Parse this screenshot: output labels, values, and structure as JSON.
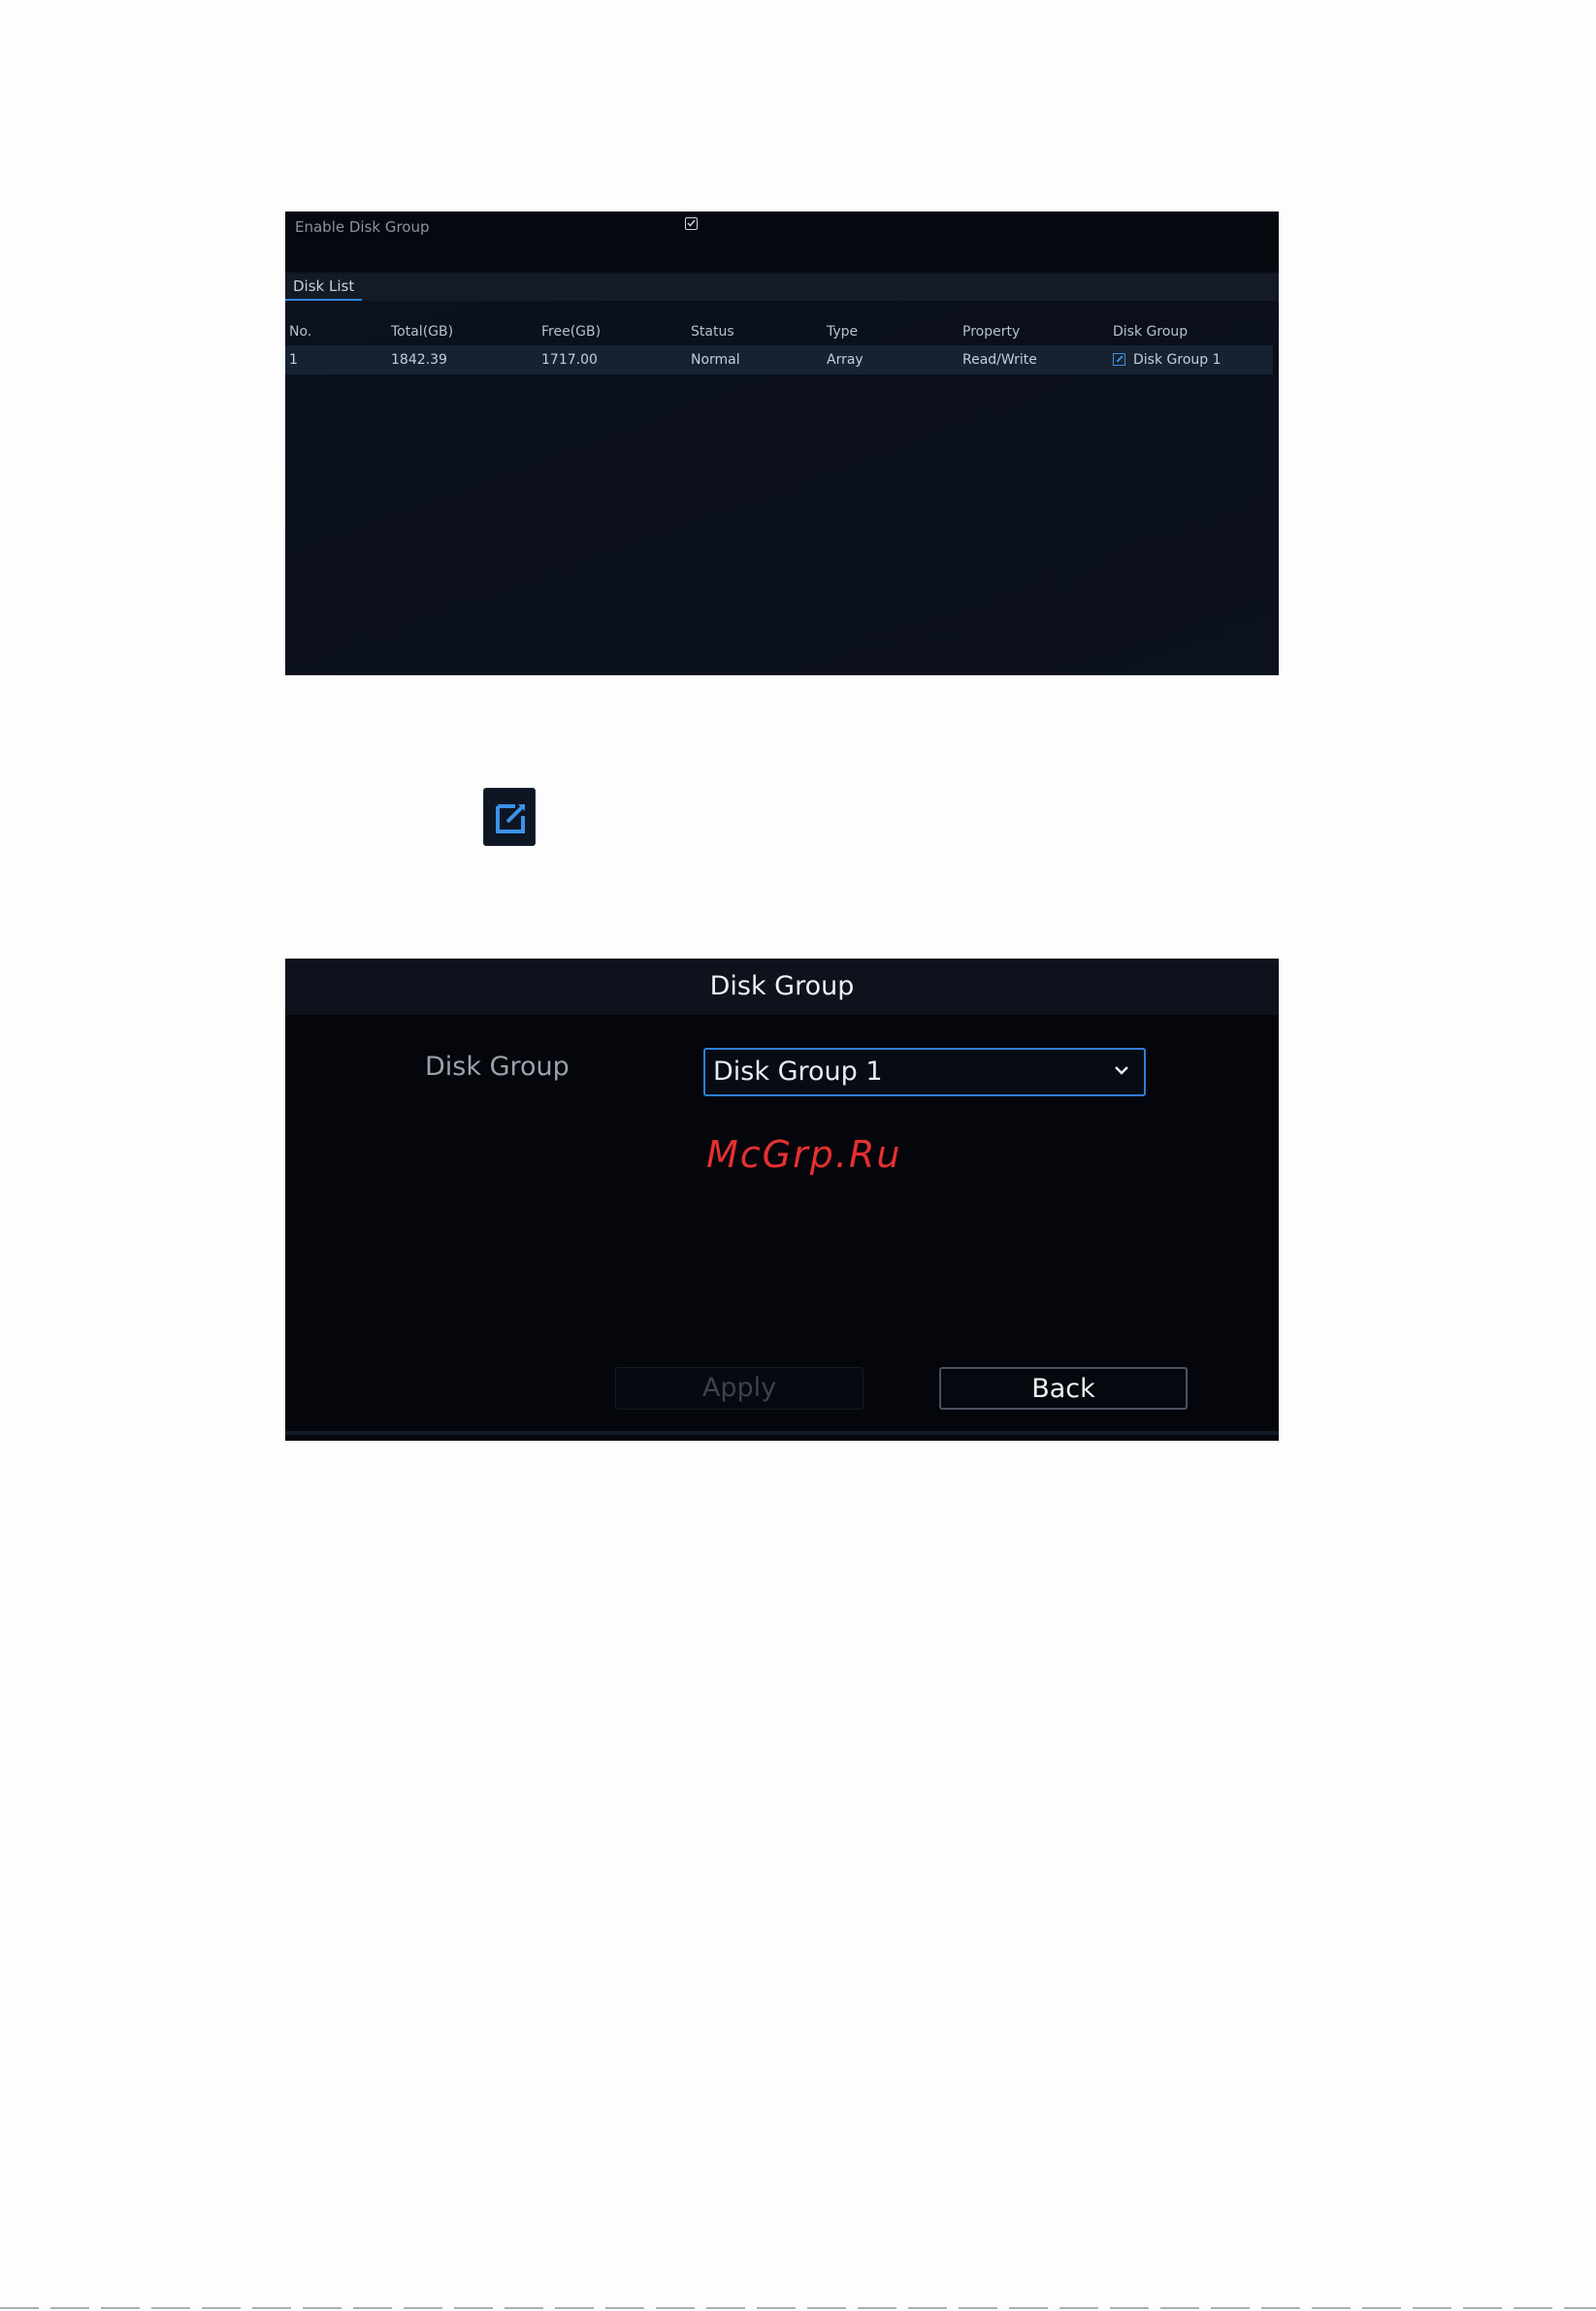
{
  "disk_list_panel": {
    "enable_label": "Enable Disk Group",
    "enable_checked": true,
    "tab_label": "Disk List",
    "columns": [
      "No.",
      "Total(GB)",
      "Free(GB)",
      "Status",
      "Type",
      "Property",
      "Disk Group"
    ],
    "rows": [
      {
        "no": "1",
        "total": "1842.39",
        "free": "1717.00",
        "status": "Normal",
        "type": "Array",
        "property": "Read/Write",
        "disk_group": "Disk Group 1"
      }
    ]
  },
  "edit_icon": "edit-icon",
  "disk_group_dialog": {
    "title": "Disk Group",
    "field_label": "Disk Group",
    "selected_value": "Disk Group 1",
    "watermark": "McGrp.Ru",
    "apply_label": "Apply",
    "back_label": "Back"
  },
  "colors": {
    "accent": "#2f7fd6",
    "watermark": "#e53030",
    "panel_bg": "#04060b"
  }
}
